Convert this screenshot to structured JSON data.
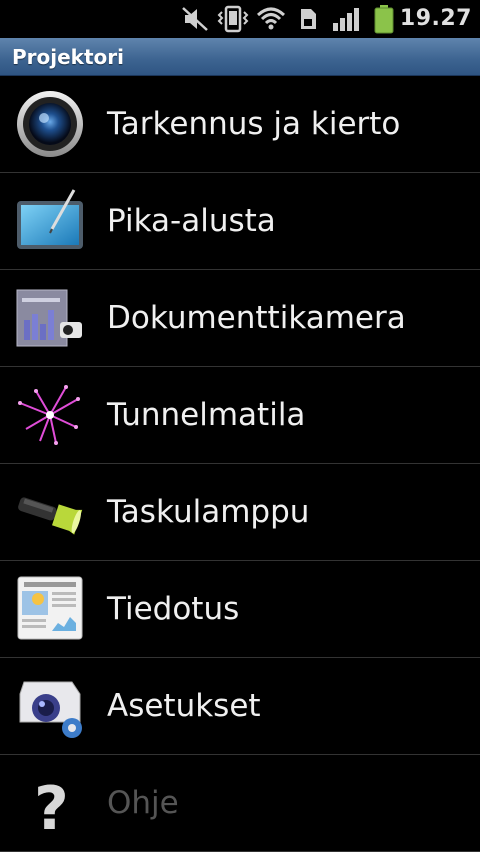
{
  "status_bar": {
    "time": "19.27",
    "icons": [
      "mute-icon",
      "vibrate-icon",
      "wifi-icon",
      "sd-card-icon",
      "signal-icon",
      "battery-icon"
    ],
    "battery_color": "#8bc34a"
  },
  "title_bar": {
    "title": "Projektori",
    "color": "#3c6390"
  },
  "menu": {
    "items": [
      {
        "label": "Tarkennus ja kierto",
        "icon": "camera-lens-icon"
      },
      {
        "label": "Pika-alusta",
        "icon": "drawing-tablet-icon"
      },
      {
        "label": "Dokumenttikamera",
        "icon": "document-camera-icon"
      },
      {
        "label": "Tunnelmatila",
        "icon": "firework-icon"
      },
      {
        "label": "Taskulamppu",
        "icon": "flashlight-icon"
      },
      {
        "label": "Tiedotus",
        "icon": "newspaper-icon"
      },
      {
        "label": "Asetukset",
        "icon": "projector-settings-icon"
      },
      {
        "label": "Ohje",
        "icon": "help-icon"
      }
    ]
  }
}
